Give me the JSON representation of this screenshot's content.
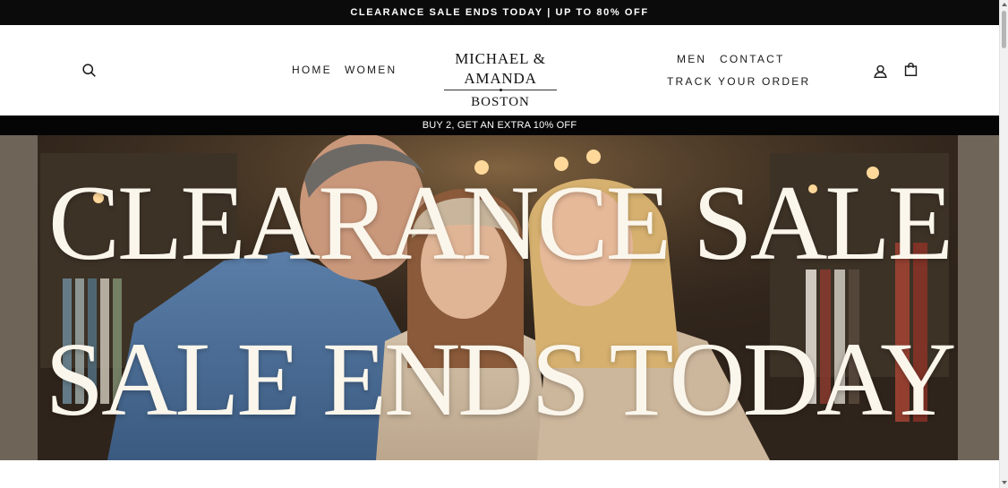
{
  "announcement": {
    "text": "CLEARANCE SALE ENDS TODAY | UP TO 80% OFF"
  },
  "header": {
    "icons": {
      "search": "search-icon",
      "account": "user-icon",
      "cart": "bag-icon"
    },
    "nav_left": [
      {
        "label": "HOME"
      },
      {
        "label": "WOMEN"
      }
    ],
    "nav_right": [
      {
        "label": "MEN"
      },
      {
        "label": "CONTACT"
      },
      {
        "label": "TRACK YOUR ORDER"
      }
    ],
    "logo": {
      "line1": "MICHAEL & AMANDA",
      "line2": "BOSTON"
    }
  },
  "promo": {
    "text": "BUY 2, GET AN EXTRA 10% OFF"
  },
  "hero": {
    "headline_1": "CLEARANCE SALE",
    "headline_2": "SALE ENDS TODAY"
  },
  "colors": {
    "bar_background": "#0b0b0b",
    "headline_text": "#fbf6ec",
    "page_background": "#ffffff"
  }
}
